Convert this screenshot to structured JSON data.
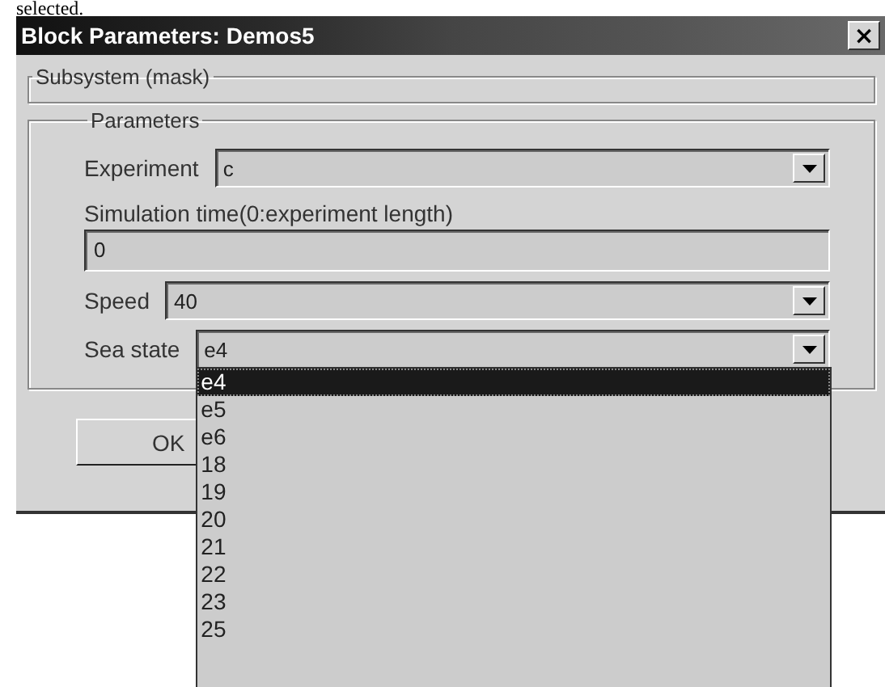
{
  "page_text": "selected.",
  "window": {
    "title": "Block Parameters: Demos5",
    "close": "×"
  },
  "subsystem_group": {
    "title": "Subsystem (mask)"
  },
  "parameters": {
    "title": "Parameters",
    "fields": [
      {
        "kind": "combo",
        "label": "Experiment",
        "value": "c"
      },
      {
        "kind": "text",
        "label": "Simulation time(0:experiment length)",
        "value": "0"
      },
      {
        "kind": "combo",
        "label": "Speed",
        "value": "40"
      },
      {
        "kind": "combo",
        "label": "Sea state",
        "value": "e4",
        "open": true
      }
    ]
  },
  "dropdown": {
    "items": [
      {
        "label": "e4",
        "selected": true
      },
      {
        "label": "e5",
        "selected": false
      },
      {
        "label": "e6",
        "selected": false
      },
      {
        "label": "18",
        "selected": false
      },
      {
        "label": "19",
        "selected": false
      },
      {
        "label": "20",
        "selected": false
      },
      {
        "label": "21",
        "selected": false
      },
      {
        "label": "22",
        "selected": false
      },
      {
        "label": "23",
        "selected": false
      },
      {
        "label": "25",
        "selected": false
      }
    ]
  },
  "buttons": [
    "OK"
  ]
}
